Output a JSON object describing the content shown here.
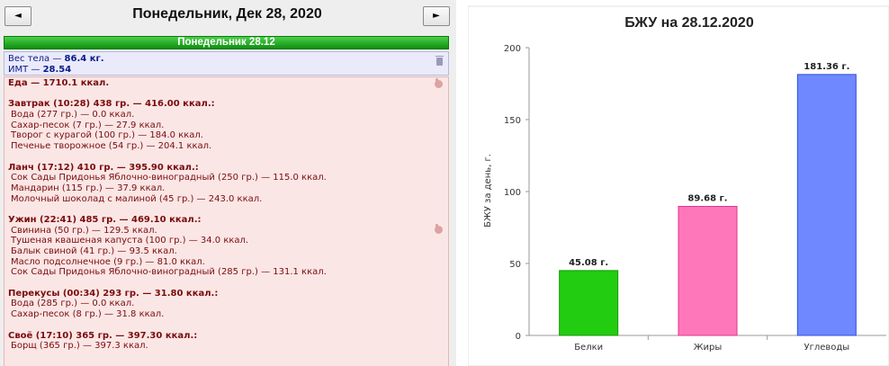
{
  "nav": {
    "prev_label": "◄",
    "next_label": "►",
    "day_title": "Понедельник, Дек 28, 2020"
  },
  "day_bar": "Понедельник 28.12",
  "body_stats": {
    "weight_label": "Вес тела — ",
    "weight_value": "86.4 кг.",
    "bmi_label": "ИМТ — ",
    "bmi_value": "28.54"
  },
  "food_total": "Еда — 1710.1 ккал.",
  "meals": [
    {
      "header": "Завтрак (10:28) 438 гр. — 416.00 ккал.:",
      "items": [
        "Вода (277 гр.) — 0.0 ккал.",
        "Сахар-песок (7 гр.) — 27.9 ккал.",
        "Творог с курагой (100 гр.) — 184.0 ккал.",
        "Печенье творожное (54 гр.) — 204.1 ккал."
      ]
    },
    {
      "header": "Ланч (17:12) 410 гр. — 395.90 ккал.:",
      "items": [
        "Сок Сады Придонья Яблочно-виноградный (250 гр.) — 115.0 ккал.",
        "Мандарин (115 гр.) — 37.9 ккал.",
        "Молочный шоколад с малиной (45 гр.) — 243.0 ккал."
      ]
    },
    {
      "header": "Ужин (22:41) 485 гр. — 469.10 ккал.:",
      "items": [
        "Свинина (50 гр.) — 129.5 ккал.",
        "Тушеная квашеная капуста (100 гр.) — 34.0 ккал.",
        "Балык свиной (41 гр.) — 93.5 ккал.",
        "Масло подсолнечное (9 гр.) — 81.0 ккал.",
        "Сок Сады Придонья Яблочно-виноградный (285 гр.) — 131.1 ккал."
      ]
    },
    {
      "header": "Перекусы (00:34) 293 гр. — 31.80 ккал.:",
      "items": [
        "Вода (285 гр.) — 0.0 ккал.",
        "Сахар-песок (8 гр.) — 31.8 ккал."
      ]
    },
    {
      "header": "Своё (17:10) 365 гр. — 397.30 ккал.:",
      "items": [
        "Борщ (365 гр.) — 397.3 ккал."
      ]
    }
  ],
  "chart_data": {
    "type": "bar",
    "title": "БЖУ на 28.12.2020",
    "ylabel": "БЖУ за день, г.",
    "xlabel": "",
    "categories": [
      "Белки",
      "Жиры",
      "Углеводы"
    ],
    "values": [
      45.08,
      89.68,
      181.36
    ],
    "data_labels": [
      "45.08 г.",
      "89.68 г.",
      "181.36 г."
    ],
    "colors": [
      "#22cc11",
      "#ff77bb",
      "#6f88ff"
    ],
    "edge_colors": [
      "#119900",
      "#e0338c",
      "#2f4ee0"
    ],
    "ylim": [
      0,
      200
    ],
    "yticks": [
      0,
      50,
      100,
      150,
      200
    ],
    "grid": false,
    "legend": "none"
  }
}
